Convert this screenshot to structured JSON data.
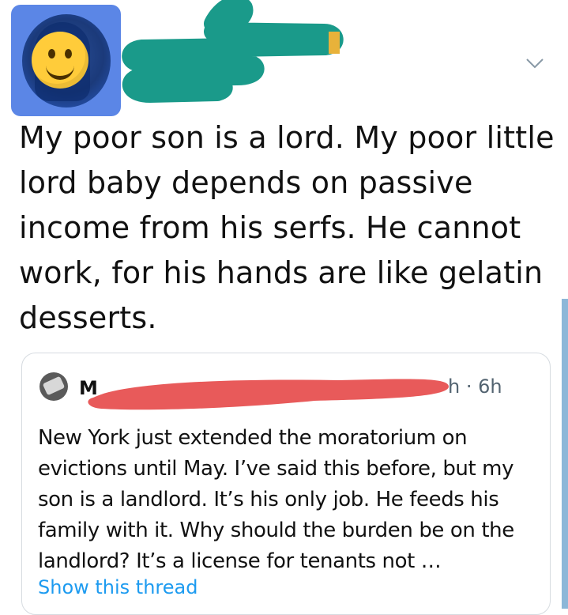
{
  "tweet": {
    "main_text": "My poor son is a lord. My poor little lord baby depends on passive income from his serfs. He cannot work, for his hands are like gelatin desserts.",
    "avatar_icon": "smiley-face-icon",
    "menu_icon": "chevron-down-icon"
  },
  "quoted": {
    "name_visible": "M",
    "time": "h · 6h",
    "text": "New York just extended the moratorium on evictions until May. I’ve said this before, but my son is a landlord. It’s his only job. He feeds his family with it. Why should the burden be on the landlord? It’s a license for tenants not …",
    "show_thread": "Show this thread"
  },
  "colors": {
    "redaction_teal": "#1a9a8a",
    "redaction_red": "#e85a5a",
    "link_blue": "#1d9bf0",
    "avatar_bg": "#5b86e6"
  }
}
